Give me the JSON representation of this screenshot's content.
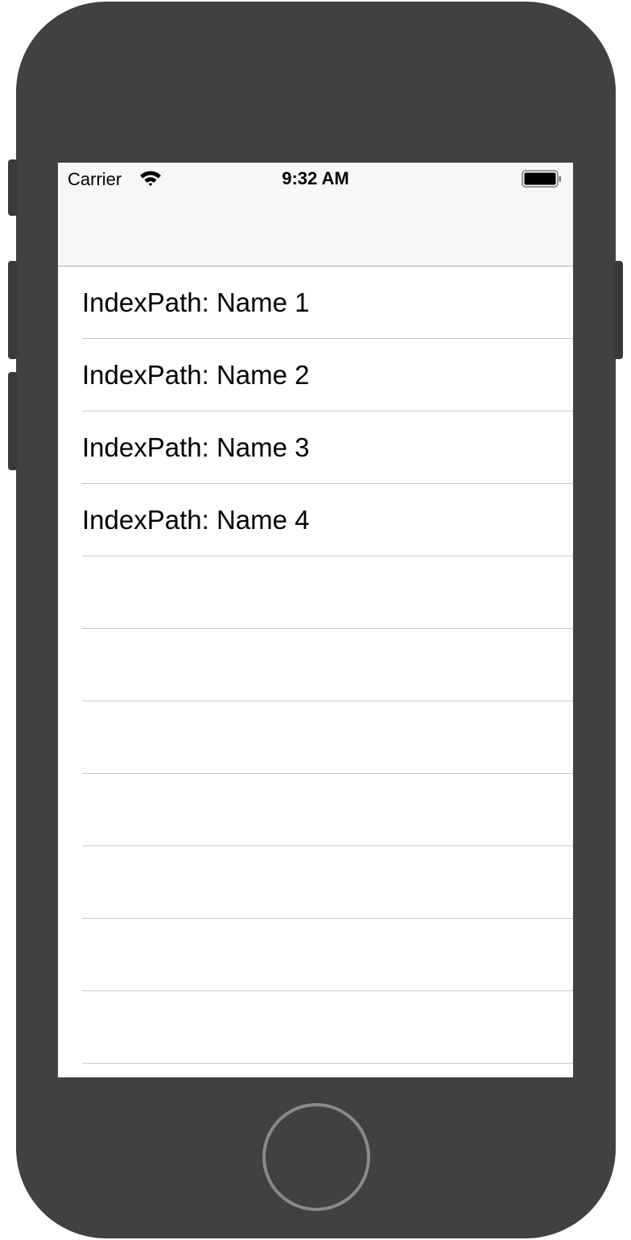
{
  "status_bar": {
    "carrier": "Carrier",
    "time": "9:32 AM",
    "wifi_icon": "wifi-icon",
    "battery_icon": "battery-icon"
  },
  "table": {
    "rows": [
      {
        "label": "IndexPath: Name 1"
      },
      {
        "label": "IndexPath: Name 2"
      },
      {
        "label": "IndexPath: Name 3"
      },
      {
        "label": "IndexPath: Name 4"
      },
      {
        "label": ""
      },
      {
        "label": ""
      },
      {
        "label": ""
      },
      {
        "label": ""
      },
      {
        "label": ""
      },
      {
        "label": ""
      },
      {
        "label": ""
      }
    ]
  },
  "colors": {
    "device_frame": "#414141",
    "bar_background": "#f7f7f7",
    "separator": "#c8c7cc"
  }
}
